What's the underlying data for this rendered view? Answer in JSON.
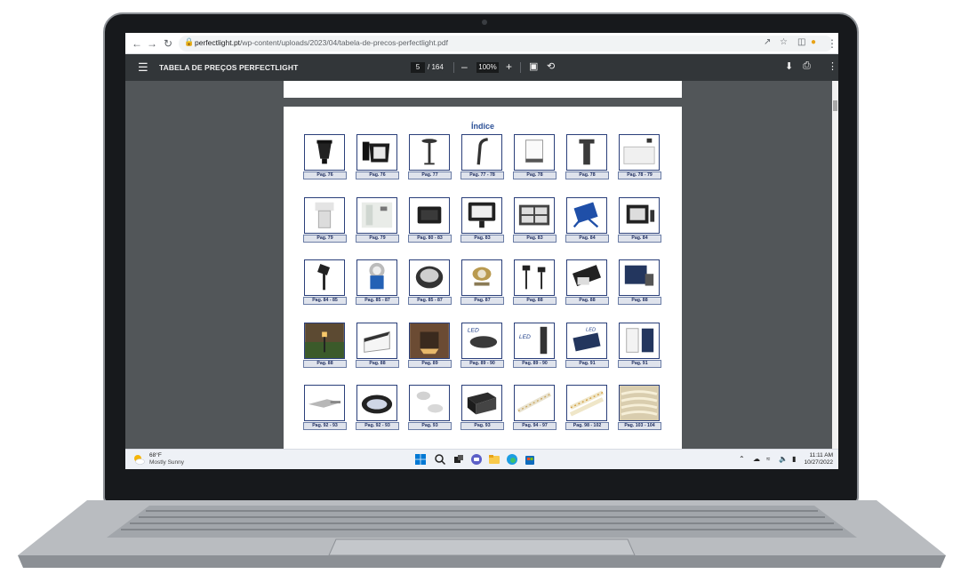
{
  "browser": {
    "url_domain": "perfectlight.pt",
    "url_path": "/wp-content/uploads/2023/04/tabela-de-precos-perfectlight.pdf",
    "back_icon": "arrow-left-icon",
    "forward_icon": "arrow-right-icon",
    "reload_icon": "reload-icon"
  },
  "pdf": {
    "title": "TABELA DE PREÇOS PERFECTLIGHT",
    "page_current": "5",
    "page_total": "/ 164",
    "zoom": "100%",
    "index_title": "Índice",
    "rows": [
      [
        {
          "caption": "Pag. 76",
          "icon": "wall-lantern"
        },
        {
          "caption": "Pag. 76",
          "icon": "wall-lantern-black"
        },
        {
          "caption": "Pag. 77",
          "icon": "bollard-slim"
        },
        {
          "caption": "Pag. 77 - 78",
          "icon": "bollard-curved"
        },
        {
          "caption": "Pag. 78",
          "icon": "wall-light-square"
        },
        {
          "caption": "Pag. 78",
          "icon": "bollard-dark"
        },
        {
          "caption": "Pag. 78 - 79",
          "icon": "wall-light-white"
        }
      ],
      [
        {
          "caption": "Pag. 79",
          "icon": "wall-light-up"
        },
        {
          "caption": "Pag. 79",
          "icon": "wall-light-room"
        },
        {
          "caption": "Pag. 80 - 83",
          "icon": "floodlight-small"
        },
        {
          "caption": "Pag. 83",
          "icon": "floodlight-stand"
        },
        {
          "caption": "Pag. 83",
          "icon": "floodlight-panel"
        },
        {
          "caption": "Pag. 84",
          "icon": "floodlight-portable"
        },
        {
          "caption": "Pag. 84",
          "icon": "floodlight-remote"
        }
      ],
      [
        {
          "caption": "Pag. 84 - 85",
          "icon": "spike-spot"
        },
        {
          "caption": "Pag. 85 - 87",
          "icon": "inground-blue"
        },
        {
          "caption": "Pag. 85 - 87",
          "icon": "inground-round"
        },
        {
          "caption": "Pag. 87",
          "icon": "underwater-spot"
        },
        {
          "caption": "Pag. 88",
          "icon": "solar-spikes"
        },
        {
          "caption": "Pag. 88",
          "icon": "solar-wall"
        },
        {
          "caption": "Pag. 88",
          "icon": "solar-flood"
        }
      ],
      [
        {
          "caption": "Pag. 88",
          "icon": "solar-garden"
        },
        {
          "caption": "Pag. 88",
          "icon": "solar-wall-white"
        },
        {
          "caption": "Pag. 89",
          "icon": "cube-wall"
        },
        {
          "caption": "Pag. 89 - 90",
          "icon": "led-street-round"
        },
        {
          "caption": "Pag. 89 - 90",
          "icon": "led-bollard"
        },
        {
          "caption": "Pag. 91",
          "icon": "solar-street"
        },
        {
          "caption": "Pag. 91",
          "icon": "solar-sensor"
        }
      ],
      [
        {
          "caption": "Pag. 92 - 93",
          "icon": "street-light"
        },
        {
          "caption": "Pag. 92 - 93",
          "icon": "highbay-ufo"
        },
        {
          "caption": "Pag. 93",
          "icon": "street-lamps"
        },
        {
          "caption": "Pag. 93",
          "icon": "wallpack"
        },
        {
          "caption": "Pag. 94 - 97",
          "icon": "led-strip"
        },
        {
          "caption": "Pag. 98 - 102",
          "icon": "led-strip-warm"
        },
        {
          "caption": "Pag. 103 - 104",
          "icon": "neon-flex"
        }
      ]
    ]
  },
  "taskbar": {
    "temperature": "68°F",
    "weather": "Mostly Sunny",
    "time": "11:11 AM",
    "date": "10/27/2022"
  },
  "colors": {
    "toolbar": "#323639",
    "doc_background": "#525659",
    "index_title": "#2a4f96",
    "thumb_border": "#2a3f7a"
  }
}
